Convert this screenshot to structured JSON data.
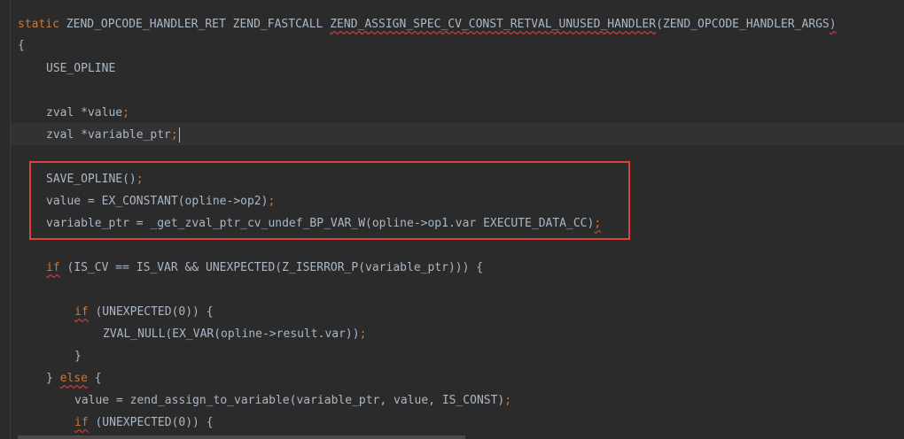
{
  "code": {
    "l1_static": "static",
    "l1_sig": " ZEND_OPCODE_HANDLER_RET ZEND_FASTCALL ",
    "l1_name": "ZEND_ASSIGN_SPEC_CV_CONST_RETVAL_UNUSED_HANDLER",
    "l1_args": "(ZEND_OPCODE_HANDLER_ARGS",
    "l1_close": ")",
    "l2": "{",
    "l3": "USE_OPLINE",
    "l5_a": "zval *value",
    "l5_semi": ";",
    "l6_a": "zval *variable_ptr",
    "l6_semi": ";",
    "l8_a": "SAVE_OPLINE()",
    "l8_semi": ";",
    "l9_a": "value = EX_CONSTANT(opline->op2)",
    "l9_semi": ";",
    "l10_a": "variable_ptr = _get_zval_ptr_cv_undef_BP_VAR_W(opline->op1.var EXECUTE_DATA_CC)",
    "l10_semi": ";",
    "l12_if": "if",
    "l12_rest": " (IS_CV == IS_VAR && UNEXPECTED(Z_ISERROR_P(variable_ptr))) {",
    "l14_if": "if",
    "l14_rest": " (UNEXPECTED(0)) {",
    "l15_a": "ZVAL_NULL(EX_VAR(opline->result.var))",
    "l15_semi": ";",
    "l16": "}",
    "l17_brace": "} ",
    "l17_else": "else",
    "l17_rest": " {",
    "l18_a": "value = zend_assign_to_variable(variable_ptr, value, IS_CONST)",
    "l18_semi": ";",
    "l19_if": "if",
    "l19_rest": " (UNEXPECTED(0)) {"
  },
  "colors": {
    "background": "#2b2b2b",
    "text": "#a9b7c6",
    "keyword": "#cc7832",
    "highlight_border": "#e0403a"
  }
}
